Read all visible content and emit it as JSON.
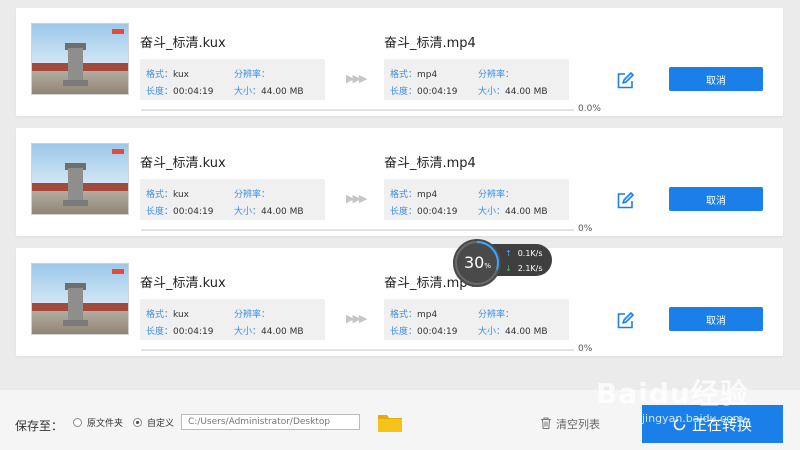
{
  "tasks": [
    {
      "source_name": "奋斗_标清.kux",
      "target_name": "奋斗_标清.mp4",
      "source": {
        "format_label": "格式：",
        "format": "kux",
        "resolution_label": "分辨率：",
        "resolution": "",
        "duration_label": "长度：",
        "duration": "00:04:19",
        "size_label": "大小：",
        "size": "44.00 MB"
      },
      "target": {
        "format_label": "格式：",
        "format": "mp4",
        "resolution_label": "分辨率：",
        "resolution": "",
        "duration_label": "长度：",
        "duration": "00:04:19",
        "size_label": "大小：",
        "size": "44.00 MB"
      },
      "cancel_label": "取消",
      "progress_text": "0.0%",
      "progress": 0
    },
    {
      "source_name": "奋斗_标清.kux",
      "target_name": "奋斗_标清.mp4",
      "source": {
        "format_label": "格式：",
        "format": "kux",
        "resolution_label": "分辨率：",
        "resolution": "",
        "duration_label": "长度：",
        "duration": "00:04:19",
        "size_label": "大小：",
        "size": "44.00 MB"
      },
      "target": {
        "format_label": "格式：",
        "format": "mp4",
        "resolution_label": "分辨率：",
        "resolution": "",
        "duration_label": "长度：",
        "duration": "00:04:19",
        "size_label": "大小：",
        "size": "44.00 MB"
      },
      "cancel_label": "取消",
      "progress_text": "0%",
      "progress": 0
    },
    {
      "source_name": "奋斗_标清.kux",
      "target_name": "奋斗_标清.mp4",
      "source": {
        "format_label": "格式：",
        "format": "kux",
        "resolution_label": "分辨率：",
        "resolution": "",
        "duration_label": "长度：",
        "duration": "00:04:19",
        "size_label": "大小：",
        "size": "44.00 MB"
      },
      "target": {
        "format_label": "格式：",
        "format": "mp4",
        "resolution_label": "分辨率：",
        "resolution": "",
        "duration_label": "长度：",
        "duration": "00:04:19",
        "size_label": "大小：",
        "size": "44.00 MB"
      },
      "cancel_label": "取消",
      "progress_text": "0%",
      "progress": 0
    }
  ],
  "speed_widget": {
    "percent": "30",
    "percent_unit": "%",
    "upload": "0.1K/s",
    "download": "2.1K/s",
    "level": 0.3
  },
  "bottom_bar": {
    "save_to_label": "保存至：",
    "option_original": "原文件夹",
    "option_custom": "自定义",
    "selected_option": "custom",
    "path_value": "C:/Users/Administrator/Desktop",
    "clear_list_label": "清空列表",
    "convert_label": "正在转换"
  },
  "watermark": {
    "text": "Baidu经验",
    "sub": "jingyan.baidu.com"
  },
  "colors": {
    "accent": "#1a7fe8",
    "label_blue": "#3a8ee6",
    "background": "#ebebeb"
  },
  "icons": {
    "edit": "edit-icon",
    "folder": "folder-icon",
    "trash": "trash-icon",
    "convert_arrows": "arrows-icon",
    "upload": "arrow-up-icon",
    "download": "arrow-down-icon"
  }
}
